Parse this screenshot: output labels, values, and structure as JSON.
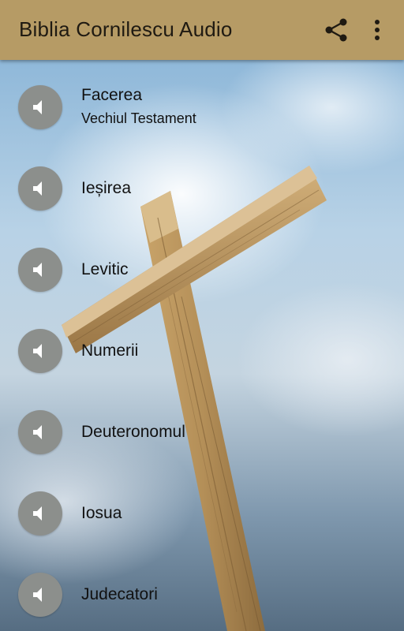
{
  "app": {
    "title": "Biblia Cornilescu Audio"
  },
  "toolbar": {
    "share_icon": "share-icon",
    "more_icon": "more-vert-icon"
  },
  "colors": {
    "appbar": "#b69b65",
    "icon_circle": "#8c8f8c"
  },
  "books": [
    {
      "title": "Facerea",
      "subtitle": "Vechiul Testament",
      "icon": "speaker-icon"
    },
    {
      "title": "Ieșirea",
      "icon": "speaker-icon"
    },
    {
      "title": "Levitic",
      "icon": "speaker-icon"
    },
    {
      "title": "Numerii",
      "icon": "speaker-icon"
    },
    {
      "title": "Deuteronomul",
      "icon": "speaker-icon"
    },
    {
      "title": "Iosua",
      "icon": "speaker-icon"
    },
    {
      "title": "Judecatori",
      "icon": "speaker-icon"
    }
  ]
}
